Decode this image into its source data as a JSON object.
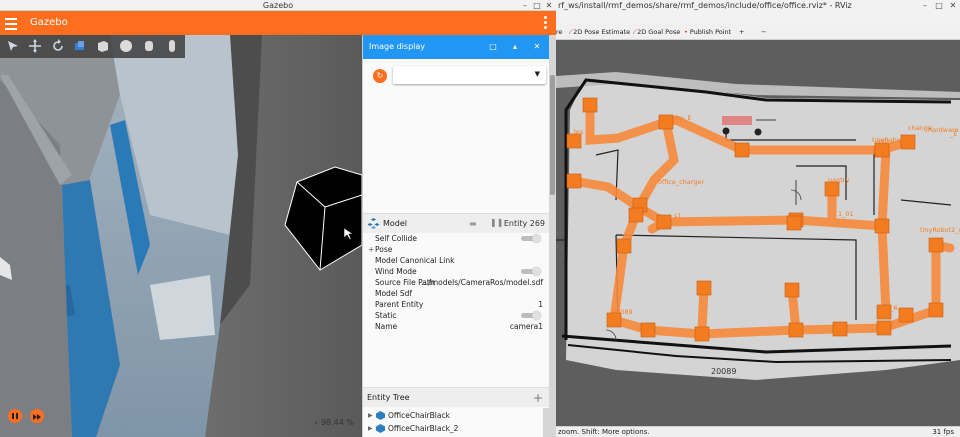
{
  "gazebo": {
    "window_title": "Gazebo",
    "app_title": "Gazebo",
    "accent_color": "#ff6e1e",
    "toolbar_icons": [
      "select-arrow-icon",
      "translate-icon",
      "rotate-icon",
      "transform-icon",
      "box-icon",
      "sphere-icon",
      "cylinder-icon",
      "capsule-icon"
    ],
    "viewport": {
      "rtf": "98.44 %",
      "arrow": "‹"
    },
    "image_display": {
      "title": "Image display",
      "topic_selected": "",
      "refresh_glyph": "↻"
    },
    "component_inspector": {
      "entity_type": "Model",
      "entity_label": "Entity 269",
      "properties": [
        {
          "key": "Self Collide",
          "value": "",
          "kind": "toggle"
        },
        {
          "key": "Pose",
          "value": "",
          "kind": "expand"
        },
        {
          "key": "Model Canonical Link",
          "value": "",
          "kind": "text"
        },
        {
          "key": "Wind Mode",
          "value": "",
          "kind": "toggle"
        },
        {
          "key": "Source File Path",
          "value": ".../models/CameraRos/model.sdf",
          "kind": "text"
        },
        {
          "key": "Model Sdf",
          "value": "",
          "kind": "text"
        },
        {
          "key": "Parent Entity",
          "value": "1",
          "kind": "text"
        },
        {
          "key": "Static",
          "value": "",
          "kind": "toggle"
        },
        {
          "key": "Name",
          "value": "camera1",
          "kind": "text"
        }
      ]
    },
    "entity_tree": {
      "title": "Entity Tree",
      "add_glyph": "+",
      "items": [
        "OfficeChairBlack",
        "OfficeChairBlack_2"
      ]
    }
  },
  "rviz": {
    "window_title": "rf_ws/install/rmf_demos/share/rmf_demos/include/office/office.rviz* - RViz",
    "toolbar": [
      {
        "label": "re",
        "marker": ""
      },
      {
        "label": "2D Pose Estimate",
        "marker": "⁄"
      },
      {
        "label": "2D Goal Pose",
        "marker": "⁄"
      },
      {
        "label": "Publish Point",
        "marker": "•"
      },
      {
        "label": "+",
        "marker": ""
      },
      {
        "label": "−",
        "marker": ""
      }
    ],
    "status_help": "zoom. Shift: More options.",
    "status_help_bold": "Shift:",
    "fps": "31 fps",
    "map": {
      "lane_color": "#f78a3c",
      "waypoint_color": "#f47c20",
      "labels": [
        "les",
        "ntry_E",
        "office_charger",
        "s1",
        "pantry",
        "1_01",
        "tinyRobot",
        "office",
        "_E",
        "hardware",
        "change",
        "hardware_2",
        "20089",
        "n_6",
        "tinyRobot2_charger",
        "cubicle"
      ]
    }
  }
}
